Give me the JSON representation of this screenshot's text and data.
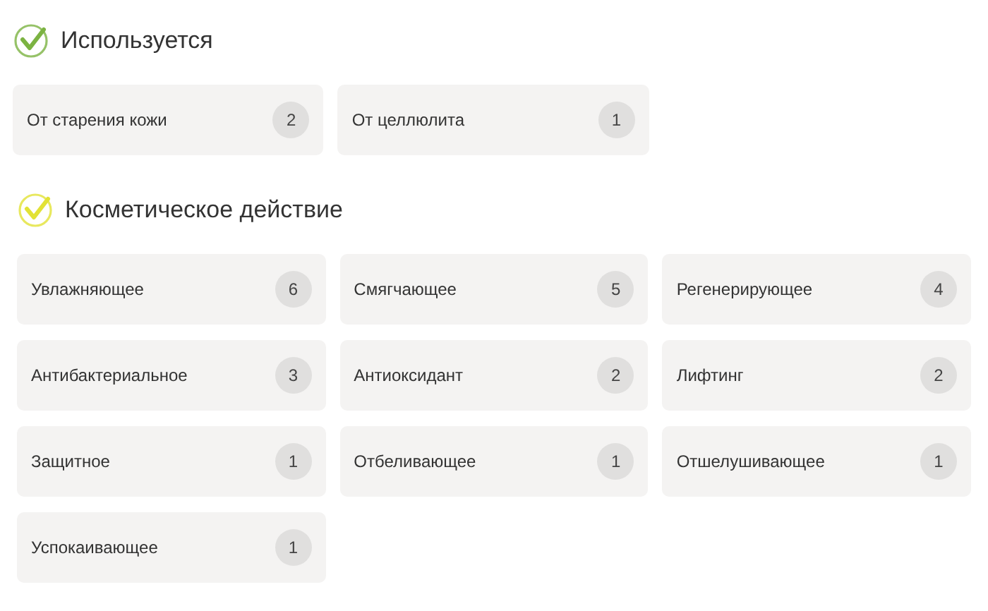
{
  "sections": [
    {
      "title": "Используется",
      "color": "#7cb342",
      "items": [
        {
          "label": "От старения кожи",
          "count": "2"
        },
        {
          "label": "От целлюлита",
          "count": "1"
        }
      ]
    },
    {
      "title": "Косметическое действие",
      "color": "#e2e236",
      "items": [
        {
          "label": "Увлажняющее",
          "count": "6"
        },
        {
          "label": "Смягчающее",
          "count": "5"
        },
        {
          "label": "Регенерирующее",
          "count": "4"
        },
        {
          "label": "Антибактериальное",
          "count": "3"
        },
        {
          "label": "Антиоксидант",
          "count": "2"
        },
        {
          "label": "Лифтинг",
          "count": "2"
        },
        {
          "label": "Защитное",
          "count": "1"
        },
        {
          "label": "Отбеливающее",
          "count": "1"
        },
        {
          "label": "Отшелушивающее",
          "count": "1"
        },
        {
          "label": "Успокаивающее",
          "count": "1"
        }
      ]
    }
  ]
}
